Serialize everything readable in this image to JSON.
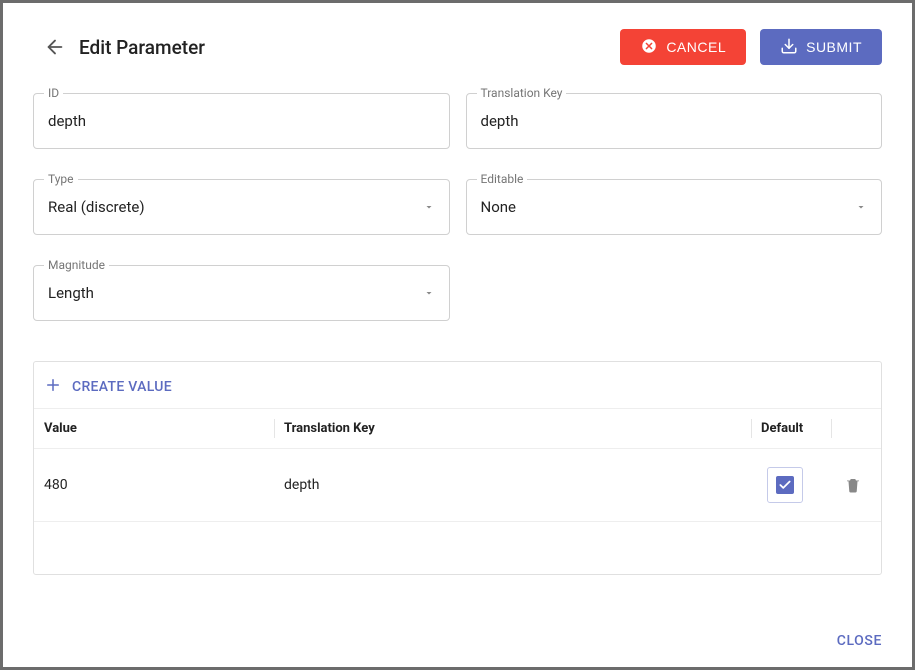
{
  "header": {
    "title": "Edit Parameter",
    "cancel_label": "CANCEL",
    "submit_label": "SUBMIT"
  },
  "fields": {
    "id": {
      "label": "ID",
      "value": "depth"
    },
    "translation_key": {
      "label": "Translation Key",
      "value": "depth"
    },
    "type": {
      "label": "Type",
      "value": "Real (discrete)"
    },
    "editable": {
      "label": "Editable",
      "value": "None"
    },
    "magnitude": {
      "label": "Magnitude",
      "value": "Length"
    }
  },
  "values_panel": {
    "create_label": "CREATE VALUE",
    "columns": {
      "value": "Value",
      "translation_key": "Translation Key",
      "default": "Default"
    },
    "rows": [
      {
        "value": "480",
        "translation_key": "depth",
        "default": true
      }
    ]
  },
  "footer": {
    "close_label": "CLOSE"
  }
}
